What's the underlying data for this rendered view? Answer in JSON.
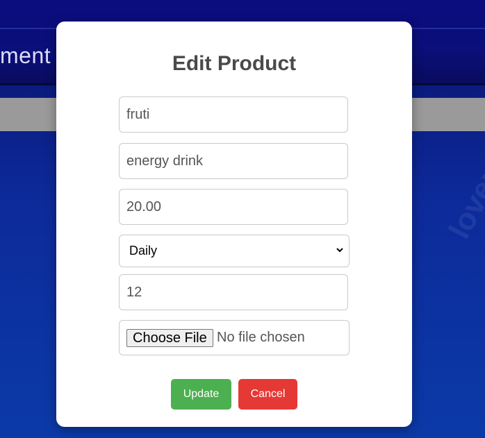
{
  "background": {
    "header_title": "ment",
    "watermark": "lovepik",
    "colors": {
      "primary_blue": "#0b0c7e",
      "gray_bar": "#9a9a9a"
    }
  },
  "modal": {
    "title": "Edit Product",
    "fields": {
      "name": "fruti",
      "description": "energy drink",
      "price": "20.00",
      "category": "Daily",
      "quantity": "12"
    },
    "file": {
      "button_label": "Choose File",
      "status": "No file chosen"
    },
    "buttons": {
      "update": "Update",
      "cancel": "Cancel"
    },
    "colors": {
      "update": "#4caf50",
      "cancel": "#e53935"
    }
  }
}
